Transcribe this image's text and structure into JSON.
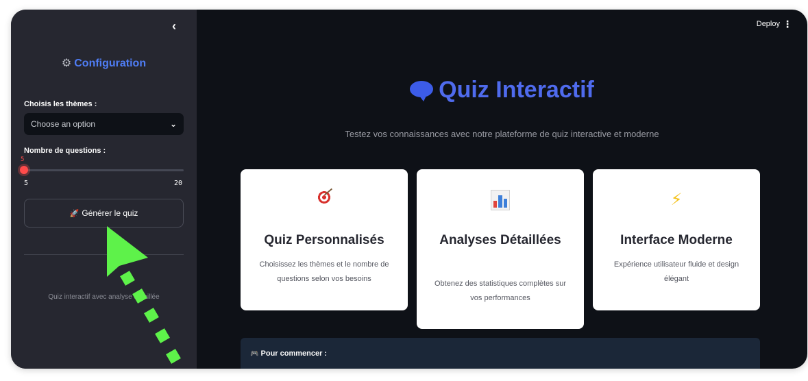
{
  "sidebar": {
    "collapse_icon": "chevron-left-icon",
    "title": "Configuration",
    "themes_label": "Choisis les thèmes :",
    "themes_placeholder": "Choose an option",
    "questions_label": "Nombre de questions :",
    "slider_value": "5",
    "slider_min": "5",
    "slider_max": "20",
    "generate_label": "Générer le quiz",
    "footer": "Quiz interactif avec analyse détaillée"
  },
  "header": {
    "deploy_label": "Deploy",
    "menu_icon": "kebab-menu-icon"
  },
  "main": {
    "title": "Quiz Interactif",
    "subtitle": "Testez vos connaissances avec notre plateforme de quiz interactive et moderne",
    "cards": [
      {
        "icon": "target-icon",
        "title": "Quiz Personnalisés",
        "desc": "Choisissez les thèmes et le nombre de questions selon vos besoins"
      },
      {
        "icon": "bar-chart-icon",
        "title": "Analyses Détaillées",
        "desc": "Obtenez des statistiques complètes sur vos performances"
      },
      {
        "icon": "lightning-icon",
        "title": "Interface Moderne",
        "desc": "Expérience utilisateur fluide et design élégant"
      }
    ],
    "start_label": "Pour commencer :"
  },
  "colors": {
    "sidebar_bg": "#262730",
    "main_bg": "#0e1117",
    "accent_blue": "#4f6bed",
    "slider_red": "#ff4b4b",
    "annotation_green": "#5ef24a"
  }
}
